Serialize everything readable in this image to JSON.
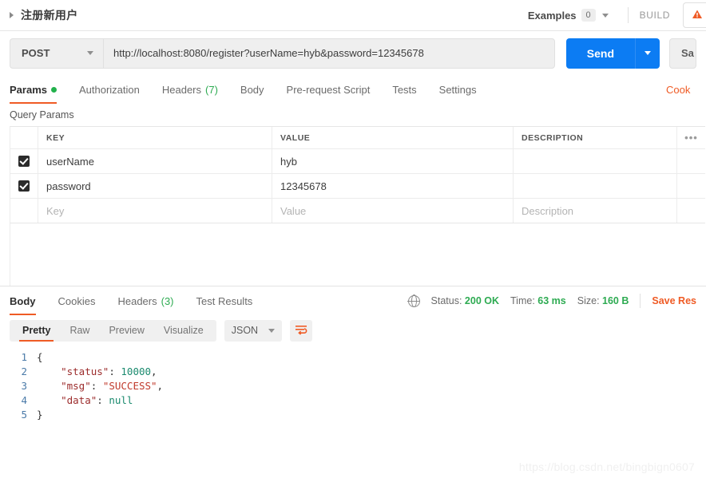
{
  "topbar": {
    "request_name": "注册新用户",
    "expand_icon": "triangle-right-icon",
    "examples_label": "Examples",
    "examples_count": "0",
    "build_label": "BUILD",
    "alert_icon": "orange-alert-icon"
  },
  "request": {
    "method": "POST",
    "url": "http://localhost:8080/register?userName=hyb&password=12345678",
    "send_label": "Send",
    "save_label": "Sa",
    "send_color": "#0c7cf3"
  },
  "request_tabs": {
    "items": [
      {
        "label": "Params",
        "badge": "",
        "dot": true,
        "active": true
      },
      {
        "label": "Authorization",
        "badge": "",
        "dot": false,
        "active": false
      },
      {
        "label": "Headers",
        "badge": "(7)",
        "dot": false,
        "active": false
      },
      {
        "label": "Body",
        "badge": "",
        "dot": false,
        "active": false
      },
      {
        "label": "Pre-request Script",
        "badge": "",
        "dot": false,
        "active": false
      },
      {
        "label": "Tests",
        "badge": "",
        "dot": false,
        "active": false
      },
      {
        "label": "Settings",
        "badge": "",
        "dot": false,
        "active": false
      }
    ],
    "cookies_link": "Cook",
    "accent_color": "#ef5b25"
  },
  "query_params": {
    "title": "Query Params",
    "columns": {
      "key": "KEY",
      "value": "VALUE",
      "description": "DESCRIPTION",
      "more": "•••"
    },
    "rows": [
      {
        "checked": true,
        "key": "userName",
        "value": "hyb",
        "description": ""
      },
      {
        "checked": true,
        "key": "password",
        "value": "12345678",
        "description": ""
      }
    ],
    "placeholder_row": {
      "key": "Key",
      "value": "Value",
      "description": "Description"
    }
  },
  "response": {
    "tabs": [
      {
        "label": "Body",
        "badge": "",
        "active": true
      },
      {
        "label": "Cookies",
        "badge": "",
        "active": false
      },
      {
        "label": "Headers",
        "badge": "(3)",
        "active": false
      },
      {
        "label": "Test Results",
        "badge": "",
        "active": false
      }
    ],
    "globe_icon": "globe-icon",
    "status_label": "Status:",
    "status_value": "200 OK",
    "time_label": "Time:",
    "time_value": "63 ms",
    "size_label": "Size:",
    "size_value": "160 B",
    "save_response": "Save Res",
    "ok_color": "#2eab52"
  },
  "body_toolbar": {
    "views": [
      {
        "label": "Pretty",
        "active": true
      },
      {
        "label": "Raw",
        "active": false
      },
      {
        "label": "Preview",
        "active": false
      },
      {
        "label": "Visualize",
        "active": false
      }
    ],
    "format": "JSON",
    "wrap_icon": "wrap-lines-icon"
  },
  "code": {
    "lines": [
      {
        "n": "1",
        "tokens": [
          {
            "t": "punct",
            "v": "{"
          }
        ]
      },
      {
        "n": "2",
        "tokens": [
          {
            "t": "punct",
            "v": "    "
          },
          {
            "t": "key",
            "v": "\"status\""
          },
          {
            "t": "punct",
            "v": ": "
          },
          {
            "t": "num",
            "v": "10000"
          },
          {
            "t": "punct",
            "v": ","
          }
        ]
      },
      {
        "n": "3",
        "tokens": [
          {
            "t": "punct",
            "v": "    "
          },
          {
            "t": "key",
            "v": "\"msg\""
          },
          {
            "t": "punct",
            "v": ": "
          },
          {
            "t": "str",
            "v": "\"SUCCESS\""
          },
          {
            "t": "punct",
            "v": ","
          }
        ]
      },
      {
        "n": "4",
        "tokens": [
          {
            "t": "punct",
            "v": "    "
          },
          {
            "t": "key",
            "v": "\"data\""
          },
          {
            "t": "punct",
            "v": ": "
          },
          {
            "t": "null",
            "v": "null"
          }
        ]
      },
      {
        "n": "5",
        "tokens": [
          {
            "t": "punct",
            "v": "}"
          }
        ]
      }
    ]
  },
  "watermark": "https://blog.csdn.net/bingbign0607"
}
